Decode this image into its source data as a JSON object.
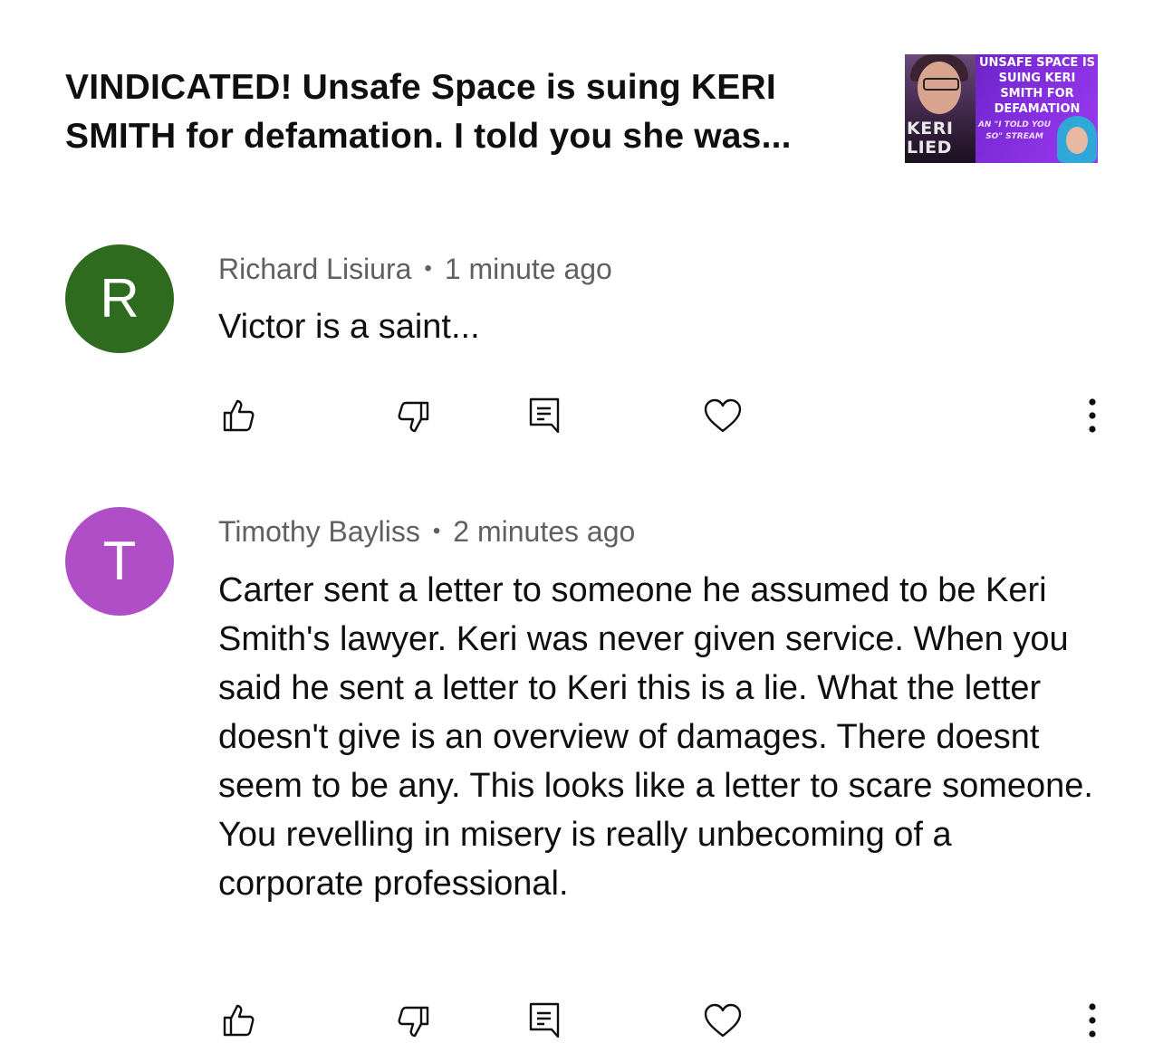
{
  "video": {
    "title": "VINDICATED! Unsafe Space is suing KERI SMITH for defamation. I told you she was...",
    "thumbnail": {
      "headline": "UNSAFE SPACE IS SUING KERI SMITH FOR DEFAMATION",
      "subline": "AN \"I TOLD YOU SO\" STREAM",
      "badge_line1": "KERI",
      "badge_line2": "LIED"
    }
  },
  "comments": [
    {
      "author": "Richard Lisiura",
      "separator": "•",
      "time": "1 minute ago",
      "avatar_letter": "R",
      "avatar_color": "#2e6b1f",
      "text": "Victor is a saint..."
    },
    {
      "author": "Timothy Bayliss",
      "separator": "•",
      "time": "2 minutes ago",
      "avatar_letter": "T",
      "avatar_color": "#b04ec8",
      "text": "Carter sent a letter to someone he assumed to be Keri Smith's lawyer. Keri was never given service. When you said he sent a letter to Keri this is a lie. What the letter doesn't give is an overview of damages. There doesnt seem to be any. This looks like a letter to scare someone. You revelling in misery is really unbecoming of a corporate professional."
    }
  ],
  "icons": {
    "like": "thumbs-up-icon",
    "dislike": "thumbs-down-icon",
    "reply": "reply-icon",
    "heart": "heart-icon",
    "more": "more-vertical-icon"
  }
}
